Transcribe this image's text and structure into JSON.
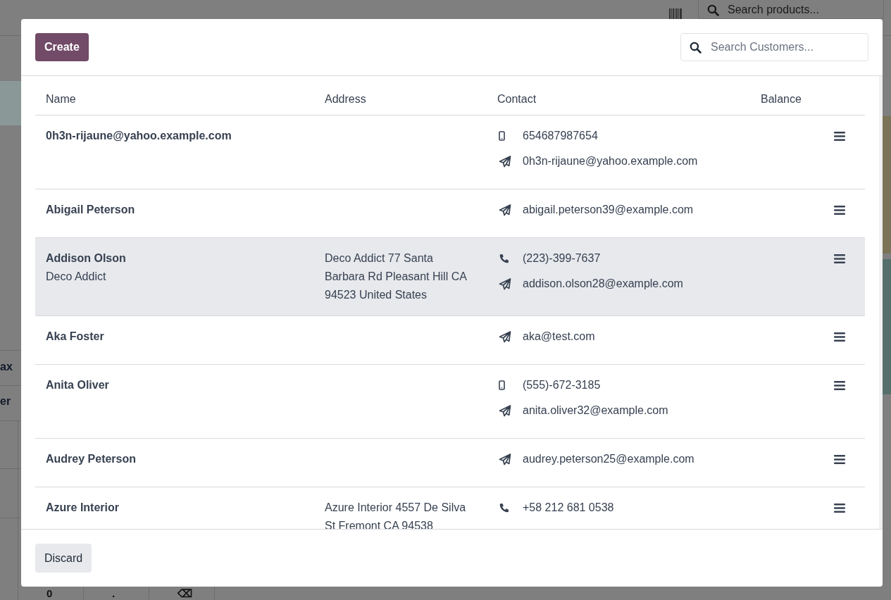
{
  "background": {
    "search": {
      "placeholder": "Search products..."
    },
    "labels": [
      "ax",
      "er"
    ],
    "keypad": [
      "0",
      ".",
      "⌫"
    ]
  },
  "dialog": {
    "create_button": "Create",
    "search": {
      "placeholder": "Search Customers..."
    },
    "table": {
      "columns": [
        "Name",
        "Address",
        "Contact",
        "Balance"
      ],
      "rows": [
        {
          "name": "0h3n-rijaune@yahoo.example.com",
          "selected": false,
          "contacts": [
            {
              "kind": "mobile",
              "text": "654687987654"
            },
            {
              "kind": "email",
              "text": "0h3n-rijaune@yahoo.example.com"
            }
          ]
        },
        {
          "name": "Abigail Peterson",
          "selected": false,
          "contacts": [
            {
              "kind": "email",
              "text": "abigail.peterson39@example.com"
            }
          ]
        },
        {
          "name": "Addison Olson",
          "company": "Deco Addict",
          "address": "Deco Addict 77 Santa Barbara Rd Pleasant Hill CA 94523 United States",
          "selected": true,
          "contacts": [
            {
              "kind": "phone",
              "text": "(223)-399-7637"
            },
            {
              "kind": "email",
              "text": "addison.olson28@example.com"
            }
          ]
        },
        {
          "name": "Aka Foster",
          "selected": false,
          "contacts": [
            {
              "kind": "email",
              "text": "aka@test.com"
            }
          ]
        },
        {
          "name": "Anita Oliver",
          "selected": false,
          "contacts": [
            {
              "kind": "mobile",
              "text": "(555)-672-3185"
            },
            {
              "kind": "email",
              "text": "anita.oliver32@example.com"
            }
          ]
        },
        {
          "name": "Audrey Peterson",
          "selected": false,
          "contacts": [
            {
              "kind": "email",
              "text": "audrey.peterson25@example.com"
            }
          ]
        },
        {
          "name": "Azure Interior",
          "address": "Azure Interior 4557 De Silva St Fremont CA 94538",
          "selected": false,
          "contacts": [
            {
              "kind": "phone",
              "text": "+58 212 681 0538"
            }
          ]
        }
      ]
    },
    "discard_button": "Discard"
  }
}
